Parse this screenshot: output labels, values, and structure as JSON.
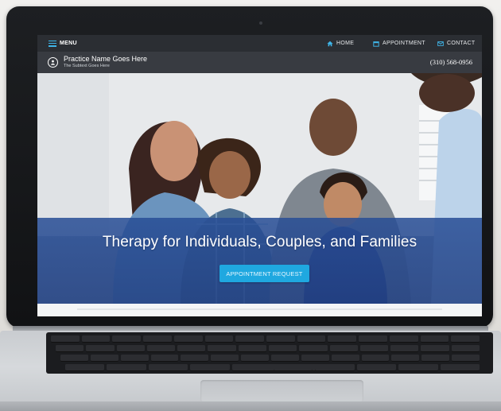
{
  "nav": {
    "menu_label": "MENU",
    "links": [
      {
        "label": "HOME",
        "icon": "home-icon"
      },
      {
        "label": "APPOINTMENT",
        "icon": "calendar-icon"
      },
      {
        "label": "CONTACT",
        "icon": "envelope-icon"
      }
    ]
  },
  "practice": {
    "name": "Practice Name Goes Here",
    "subtitle": "The Subtext Goes Here",
    "phone": "(310) 568-0956",
    "logo_icon": "person-icon"
  },
  "hero": {
    "title": "Therapy for Individuals, Couples, and Families",
    "cta_label": "APPOINTMENT REQUEST"
  },
  "colors": {
    "nav_bg": "#2b2e33",
    "practice_bg": "#383b41",
    "accent": "#3fb5e8",
    "cta": "#1fa8e0",
    "hero_band": "#284e96"
  }
}
